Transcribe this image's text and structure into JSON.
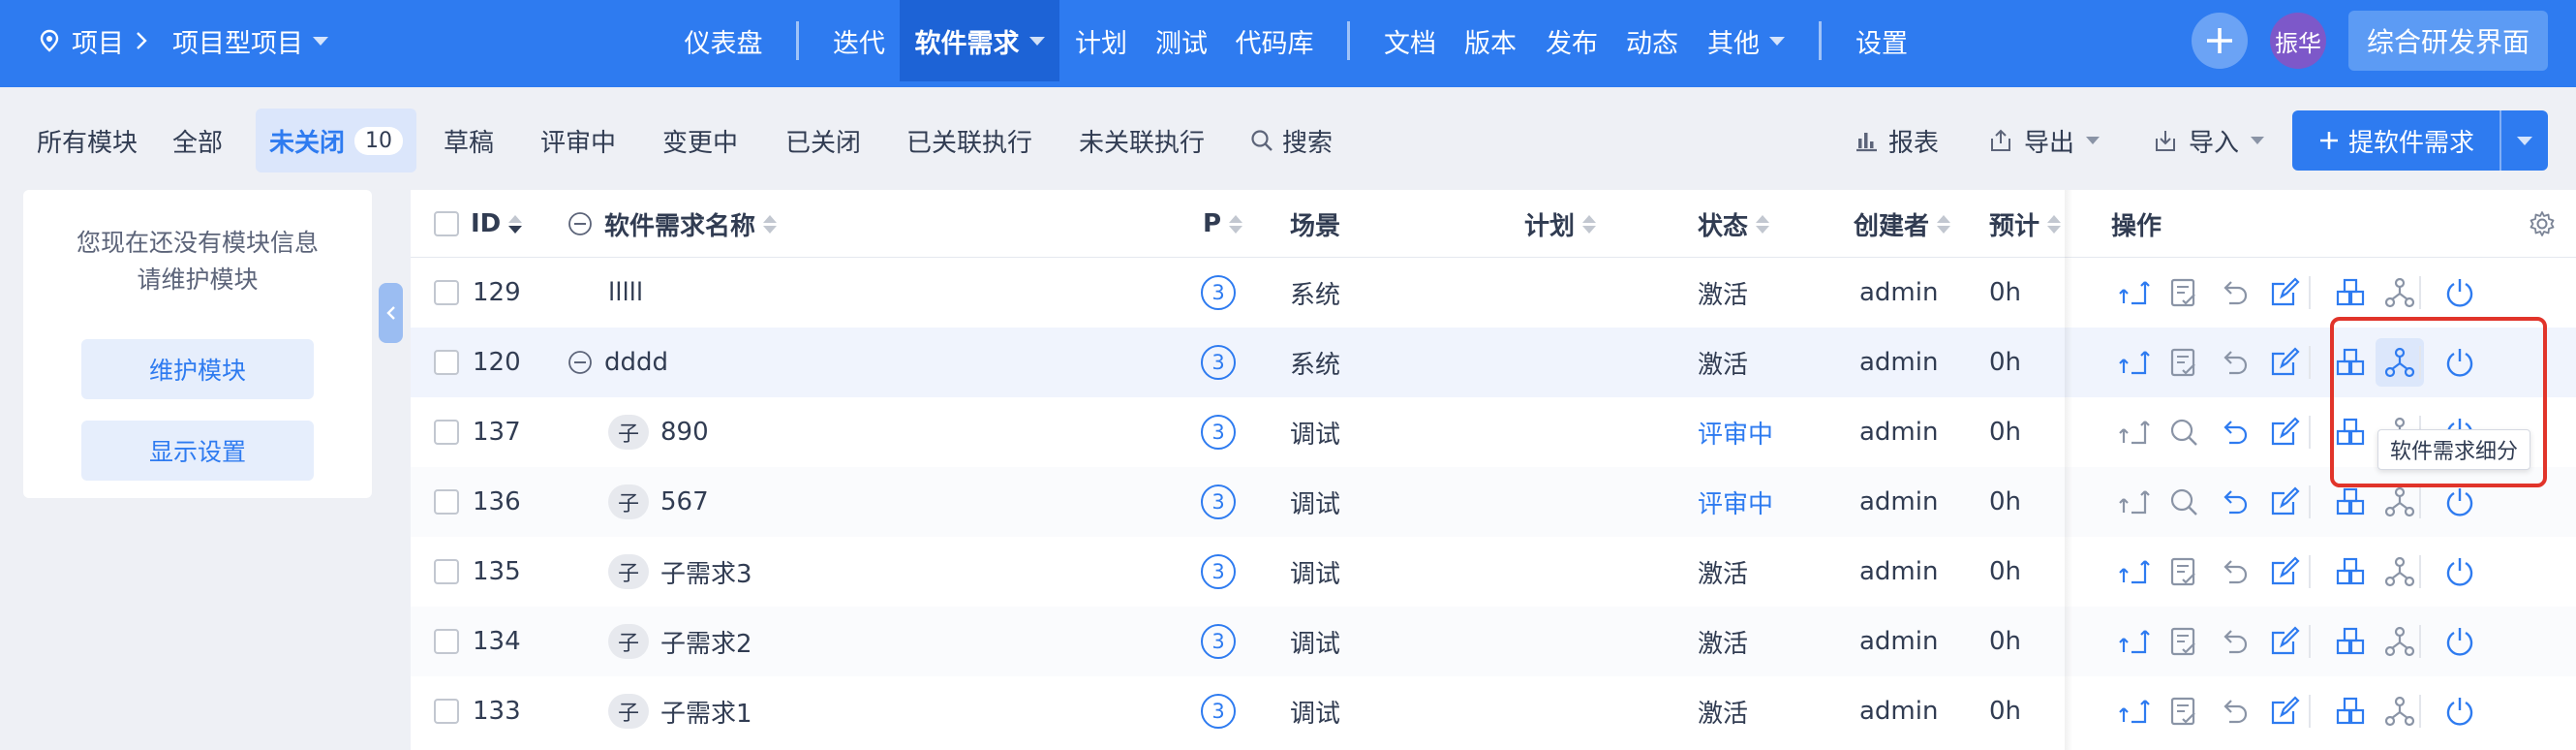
{
  "breadcrumb": {
    "home": "项目",
    "project": "项目型项目"
  },
  "nav": {
    "items": [
      "仪表盘",
      "迭代",
      "软件需求",
      "计划",
      "测试",
      "代码库",
      "文档",
      "版本",
      "发布",
      "动态",
      "其他",
      "设置"
    ],
    "active": "软件需求",
    "user": "振华",
    "interface_button": "综合研发界面"
  },
  "filters": {
    "module_label": "所有模块",
    "tabs": [
      "全部",
      "未关闭",
      "草稿",
      "评审中",
      "变更中",
      "已关闭",
      "已关联执行",
      "未关联执行"
    ],
    "active_tab": "未关闭",
    "active_count": "10",
    "search": "搜索"
  },
  "toolbar": {
    "report": "报表",
    "export": "导出",
    "import": "导入",
    "create": "提软件需求"
  },
  "sidebar": {
    "message_line1": "您现在还没有模块信息",
    "message_line2": "请维护模块",
    "maintain_button": "维护模块",
    "display_button": "显示设置"
  },
  "table": {
    "columns": {
      "id": "ID",
      "name": "软件需求名称",
      "priority": "P",
      "scene": "场景",
      "plan": "计划",
      "status": "状态",
      "creator": "创建者",
      "estimate": "预计",
      "actions": "操作"
    },
    "sub_tag": "子",
    "rows": [
      {
        "id": "129",
        "name": "lllll",
        "priority": "3",
        "scene": "系统",
        "plan": "",
        "status": "激活",
        "creator": "admin",
        "estimate": "0h",
        "child": false,
        "parent": false
      },
      {
        "id": "120",
        "name": "dddd",
        "priority": "3",
        "scene": "系统",
        "plan": "",
        "status": "激活",
        "creator": "admin",
        "estimate": "0h",
        "child": false,
        "parent": true
      },
      {
        "id": "137",
        "name": "890",
        "priority": "3",
        "scene": "调试",
        "plan": "",
        "status": "评审中",
        "creator": "admin",
        "estimate": "0h",
        "child": true,
        "parent": false
      },
      {
        "id": "136",
        "name": "567",
        "priority": "3",
        "scene": "调试",
        "plan": "",
        "status": "评审中",
        "creator": "admin",
        "estimate": "0h",
        "child": true,
        "parent": false
      },
      {
        "id": "135",
        "name": "子需求3",
        "priority": "3",
        "scene": "调试",
        "plan": "",
        "status": "激活",
        "creator": "admin",
        "estimate": "0h",
        "child": true,
        "parent": false
      },
      {
        "id": "134",
        "name": "子需求2",
        "priority": "3",
        "scene": "调试",
        "plan": "",
        "status": "激活",
        "creator": "admin",
        "estimate": "0h",
        "child": true,
        "parent": false
      },
      {
        "id": "133",
        "name": "子需求1",
        "priority": "3",
        "scene": "调试",
        "plan": "",
        "status": "激活",
        "creator": "admin",
        "estimate": "0h",
        "child": true,
        "parent": false
      }
    ]
  },
  "tooltip": "软件需求细分",
  "action_icons": [
    "change-icon",
    "review-icon",
    "recall-icon",
    "edit-icon",
    "link-case-icon",
    "split-icon",
    "close-icon"
  ],
  "colors": {
    "primary": "#2e7bf0",
    "nav_active": "#1d63d6",
    "highlight_box": "#e1342a",
    "review_status": "#2e7bf0"
  }
}
